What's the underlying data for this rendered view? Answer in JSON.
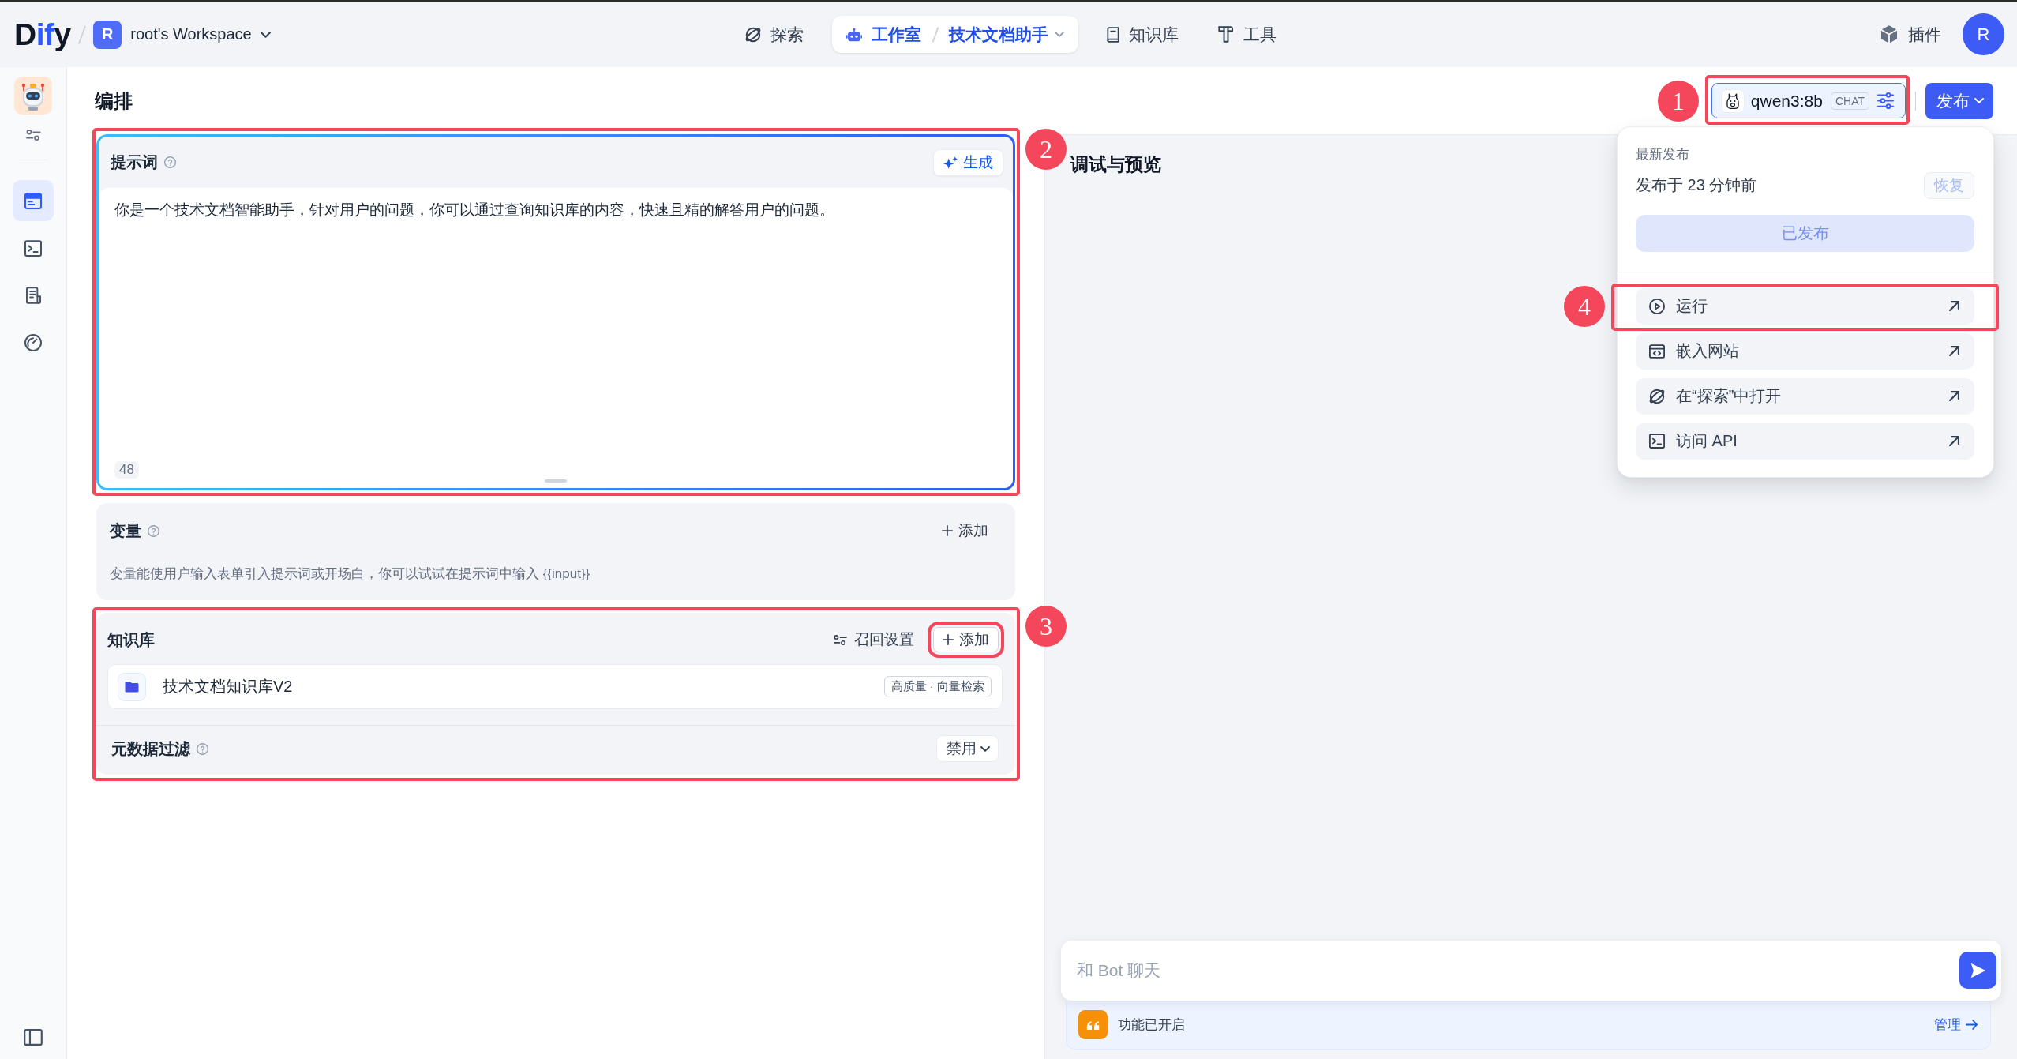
{
  "topbar": {
    "logo": "Dify",
    "workspace": {
      "avatar": "R",
      "name": "root's Workspace"
    },
    "nav": [
      {
        "label": "探索",
        "selected": false
      },
      {
        "label": "工作室",
        "selected": true,
        "current_app": "技术文档助手"
      },
      {
        "label": "知识库",
        "selected": false
      },
      {
        "label": "工具",
        "selected": false
      }
    ],
    "plugins": "插件",
    "user_avatar": "R"
  },
  "sidebar": {
    "nav": [
      {
        "selected": true
      },
      {
        "selected": false
      },
      {
        "selected": false
      },
      {
        "selected": false
      }
    ]
  },
  "header": {
    "title": "编排",
    "model_selector": {
      "model": "qwen3:8b",
      "mode": "CHAT",
      "annotation": "1"
    },
    "publish_button": "发布"
  },
  "publish_menu": {
    "caption": "最新发布",
    "published_time": "发布于 23 分钟前",
    "restore_button": {
      "label": "恢复",
      "disabled": true
    },
    "publish_button": {
      "label": "已发布",
      "disabled": true
    },
    "items": [
      {
        "label": "运行",
        "annotation": "4"
      },
      {
        "label": "嵌入网站"
      },
      {
        "label": "在“探索”中打开"
      },
      {
        "label": "访问 API"
      }
    ]
  },
  "prompt": {
    "title": "提示词",
    "generate_button": "生成",
    "text": "你是一个技术文档智能助手，针对用户的问题，你可以通过查询知识库的内容，快速且精的解答用户的问题。",
    "char_count": "48",
    "annotation": "2"
  },
  "variables": {
    "title": "变量",
    "add_button": "添加",
    "description": "变量能使用户输入表单引入提示词或开场白，你可以试试在提示词中输入 {{input}}"
  },
  "knowledge": {
    "title": "知识库",
    "annotation": "3",
    "retrieval_settings": "召回设置",
    "add_button": {
      "label": "添加",
      "highlighted": true
    },
    "datasets": [
      {
        "name": "技术文档知识库V2",
        "tag": "高质量 · 向量检索"
      }
    ],
    "metadata_filter": {
      "title": "元数据过滤",
      "value": "禁用"
    }
  },
  "debug": {
    "title": "调试与预览",
    "chat_input": {
      "placeholder": "和 Bot 聊天"
    },
    "features": {
      "label": "功能已开启",
      "link": "管理"
    }
  }
}
